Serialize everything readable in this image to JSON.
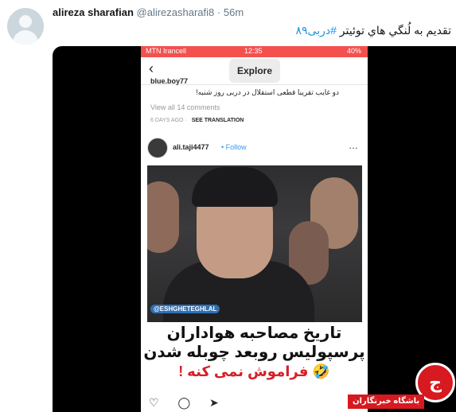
{
  "tweet": {
    "author_name": "alireza sharafian",
    "handle": "@alirezasharafi8",
    "separator": "·",
    "time": "56m",
    "text_prefix": "تقديم به لُنگي هاي توئيتر ",
    "hashtag": "#دربی۸۹"
  },
  "phone": {
    "carrier": "MTN Irancell",
    "time": "12:35",
    "battery": "40%",
    "nav_title": "Explore",
    "back_icon": "chevron-left-icon"
  },
  "comment": {
    "username": "blue.boy77",
    "text": "دو غایب تقریبا قطعی استقلال در دربی روز شنبه!",
    "view_all": "View all 14 comments",
    "date": "6 DAYS AGO",
    "separator": "·",
    "translate": "SEE TRANSLATION"
  },
  "post": {
    "username": "ali.taji4477",
    "separator": "•",
    "follow": "Follow",
    "more_icon": "…"
  },
  "video": {
    "logo": "@ESHGHETEGHLAL"
  },
  "caption": {
    "line1": "تاریخ مصاحبه هواداران",
    "line2": "پرسپولیس روبعد چوبله شدن",
    "line3": "فراموش نمی کنه !",
    "emoji": "🤣"
  },
  "actions": {
    "icons": "♡ ◯ ➤"
  },
  "watermark": {
    "mark": "ج",
    "label": "باشگاه خبرنگاران"
  },
  "colors": {
    "link": "#1b95e0",
    "status_bar": "#f3504e",
    "follow": "#3897f0",
    "brand_red": "#d71920"
  }
}
